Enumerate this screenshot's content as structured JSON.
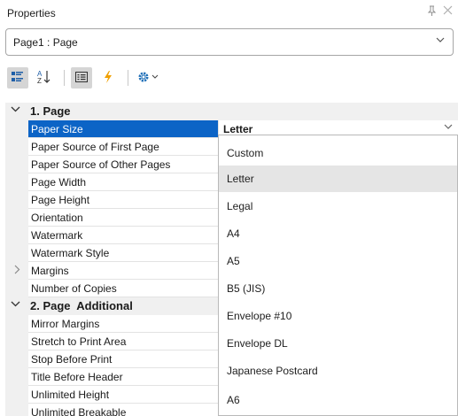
{
  "panel": {
    "title": "Properties",
    "pin_icon": "pin-icon",
    "close_icon": "close-icon"
  },
  "object_selector": {
    "value": "Page1 : Page",
    "icon": "chevron-down-icon"
  },
  "toolbar": {
    "buttons": [
      {
        "icon": "categorized-icon",
        "active": true
      },
      {
        "icon": "sort-alphabetical-icon",
        "label": "A↓"
      },
      {
        "icon": "properties-icon",
        "active": true
      },
      {
        "icon": "events-lightning-icon"
      },
      {
        "icon": "settings-gear-icon"
      }
    ]
  },
  "categories": [
    {
      "label": "1. Page",
      "properties": [
        {
          "name": "Paper Size",
          "value": "Letter",
          "selected": true
        },
        {
          "name": "Paper Source of First Page"
        },
        {
          "name": "Paper Source of Other Pages"
        },
        {
          "name": "Page Width"
        },
        {
          "name": "Page Height"
        },
        {
          "name": "Orientation"
        },
        {
          "name": "Watermark"
        },
        {
          "name": "Watermark Style"
        },
        {
          "name": "Margins",
          "expandable": true
        },
        {
          "name": "Number of Copies"
        }
      ]
    },
    {
      "label": "2. Page  Additional",
      "properties": [
        {
          "name": "Mirror Margins"
        },
        {
          "name": "Stretch to Print Area"
        },
        {
          "name": "Stop Before Print"
        },
        {
          "name": "Title Before Header"
        },
        {
          "name": "Unlimited Height"
        },
        {
          "name": "Unlimited Breakable"
        }
      ]
    }
  ],
  "dropdown": {
    "highlighted": "Letter",
    "options": [
      "Custom",
      "Letter",
      "Legal",
      "A4",
      "A5",
      "B5 (JIS)",
      "Envelope #10",
      "Envelope DL",
      "Japanese Postcard",
      "A6"
    ]
  },
  "colors": {
    "selection": "#0c64c6",
    "category_bg": "#f0f0f0",
    "hover": "#e5e5e5"
  }
}
